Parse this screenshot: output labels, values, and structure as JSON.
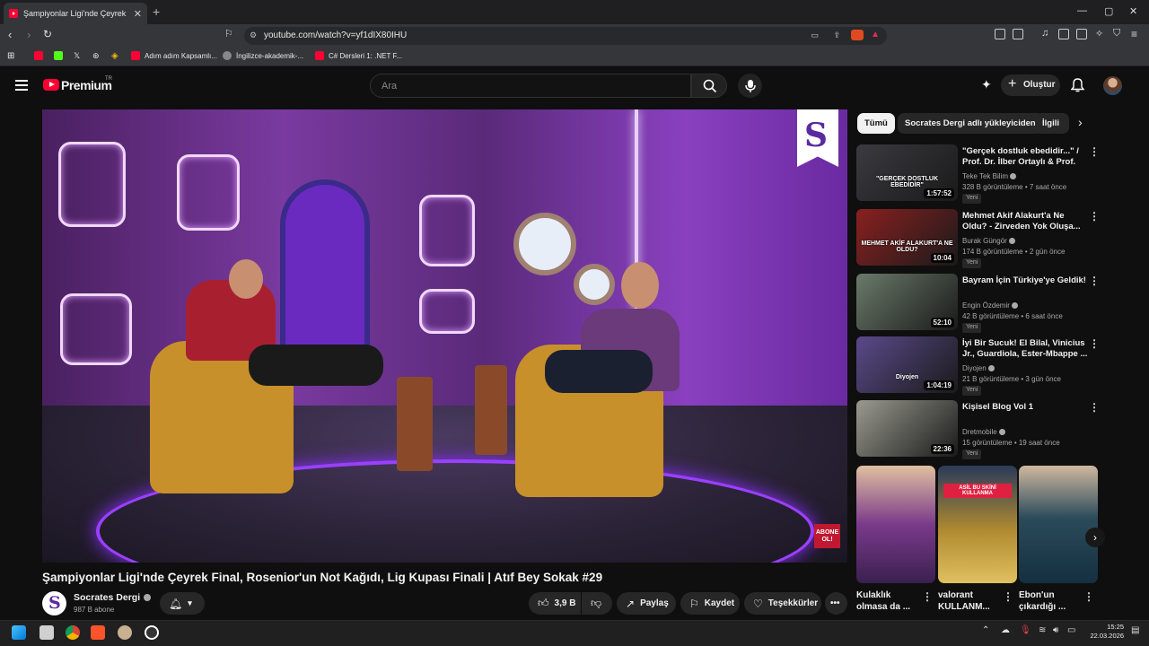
{
  "browser": {
    "tab_title": "Şampiyonlar Ligi'nde Çeyrek Final...",
    "url": "youtube.com/watch?v=yf1dIX80IHU",
    "bookmarks": [
      "Adım adım Kapsamlı...",
      "İngilizce-akademik-...",
      "C# Dersleri 1: .NET F..."
    ]
  },
  "header": {
    "logo_text": "Premium",
    "logo_tm": "TR",
    "search_placeholder": "Ara",
    "create_label": "Oluştur"
  },
  "video": {
    "title": "Şampiyonlar Ligi'nde Çeyrek Final, Rosenior'un Not Kağıdı, Lig Kupası Finali | Atıf Bey Sokak #29",
    "channel_logo_letter": "S",
    "overlay_badge": "ABONE OL!",
    "channel": "Socrates Dergi",
    "subscribers": "987 B abone",
    "likes": "3,9 B",
    "share_label": "Paylaş",
    "save_label": "Kaydet",
    "thanks_label": "Teşekkürler"
  },
  "chips": [
    "Tümü",
    "Socrates Dergi adlı yükleyiciden",
    "İlgili"
  ],
  "recommendations": [
    {
      "title": "\"Gerçek dostluk ebedidir...\" / Prof. Dr. İlber Ortaylı & Prof. Dr...",
      "channel": "Teke Tek Bilim",
      "meta": "328 B görüntüleme • 7 saat önce",
      "badge": "Yeni",
      "duration": "1:57:52",
      "thumb_text": "\"GERÇEK DOSTLUK EBEDİDİR\"",
      "color": "#3a3a40"
    },
    {
      "title": "Mehmet Akif Alakurt'a Ne Oldu? - Zirveden Yok Oluşa...",
      "channel": "Burak Güngör",
      "meta": "174 B görüntüleme • 2 gün önce",
      "badge": "Yeni",
      "duration": "10:04",
      "thumb_text": "MEHMET AKİF ALAKURT'A NE OLDU?",
      "color": "#8a2020"
    },
    {
      "title": "Bayram İçin Türkiye'ye Geldik!",
      "channel": "Engin Özdemir",
      "meta": "42 B görüntüleme • 6 saat önce",
      "badge": "Yeni",
      "duration": "52:10",
      "thumb_text": "",
      "color": "#6a7a6a"
    },
    {
      "title": "İyi Bir Sucuk! El Bilal, Vinicius Jr., Guardiola, Ester-Mbappe ...",
      "channel": "Diyojen",
      "meta": "21 B görüntüleme • 3 gün önce",
      "badge": "Yeni",
      "duration": "1:04:19",
      "thumb_text": "Diyojen",
      "color": "#5a4a8a"
    },
    {
      "title": "Kişisel Blog Vol 1",
      "channel": "Dretmobile",
      "meta": "15 görüntüleme • 19 saat önce",
      "badge": "Yeni",
      "duration": "22:36",
      "thumb_text": "",
      "color": "#9a9a90"
    }
  ],
  "shorts": [
    {
      "title": "Kulaklık olmasa da ...",
      "color": "#7a3a8a"
    },
    {
      "title": "valorant KULLANM...",
      "thumb_text": "ASİL BU SKİNİ KULLANMA",
      "color": "#b08a30"
    },
    {
      "title": "Ebon'un çıkardığı ...",
      "color": "#2a4a5a"
    }
  ],
  "taskbar": {
    "time": "15:25",
    "date": "22.03.2026"
  }
}
